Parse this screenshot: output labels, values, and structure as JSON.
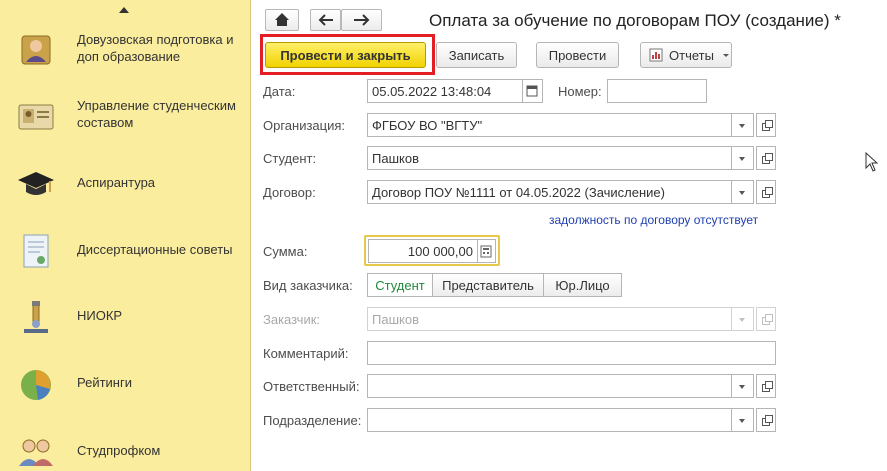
{
  "sidebar": {
    "items": [
      {
        "label": "Довузовская подготовка и доп образование",
        "icon": "student-person-icon"
      },
      {
        "label": "Управление студенческим составом",
        "icon": "student-card-icon"
      },
      {
        "label": "Аспирантура",
        "icon": "graduation-cap-icon"
      },
      {
        "label": "Диссертационные советы",
        "icon": "diploma-document-icon"
      },
      {
        "label": "НИОКР",
        "icon": "microscope-icon"
      },
      {
        "label": "Рейтинги",
        "icon": "pie-chart-icon"
      },
      {
        "label": "Студпрофком",
        "icon": "people-group-icon"
      }
    ]
  },
  "header": {
    "title": "Оплата за обучение по договорам ПОУ (создание) *",
    "home_icon": "home-icon",
    "back_icon": "arrow-left-icon",
    "forward_icon": "arrow-right-icon"
  },
  "toolbar": {
    "post_close_label": "Провести и закрыть",
    "save_label": "Записать",
    "post_label": "Провести",
    "reports_label": "Отчеты",
    "highlight_color": "#e41e25"
  },
  "form": {
    "date": {
      "label": "Дата:",
      "value": "05.05.2022 13:48:04"
    },
    "number": {
      "label": "Номер:",
      "value": ""
    },
    "organization": {
      "label": "Организация:",
      "value": "ФГБОУ ВО \"ВГТУ\""
    },
    "student": {
      "label": "Студент:",
      "value": "Пашков"
    },
    "contract": {
      "label": "Договор:",
      "value": "Договор ПОУ №1111 от 04.05.2022 (Зачисление)"
    },
    "debt_note": "задолжность по договору отсутствует",
    "amount": {
      "label": "Сумма:",
      "value": "100 000,00"
    },
    "customer_type": {
      "label": "Вид заказчика:",
      "options": [
        "Студент",
        "Представитель",
        "Юр.Лицо"
      ],
      "selected": "Студент"
    },
    "customer": {
      "label": "Заказчик:",
      "value": "Пашков"
    },
    "comment": {
      "label": "Комментарий:",
      "value": ""
    },
    "responsible": {
      "label": "Ответственный:",
      "value": ""
    },
    "department": {
      "label": "Подразделение:",
      "value": ""
    }
  }
}
